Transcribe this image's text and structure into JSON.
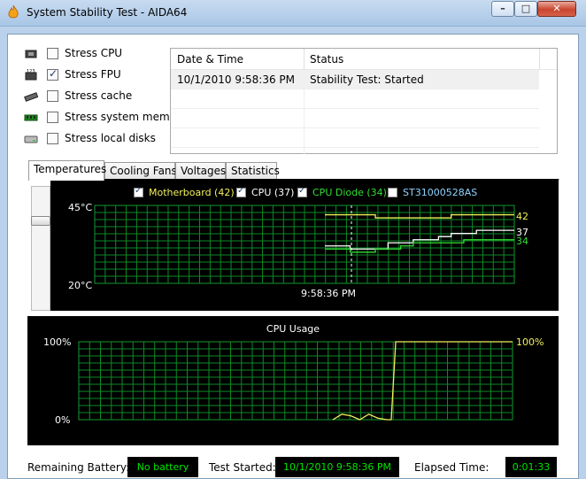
{
  "window": {
    "title": "System Stability Test - AIDA64"
  },
  "titlebar": {
    "minimize": "–",
    "maximize": "□",
    "close": "✕"
  },
  "stress_options": [
    {
      "label": "Stress CPU",
      "checked": false,
      "icon": "cpu-icon"
    },
    {
      "label": "Stress FPU",
      "checked": true,
      "icon": "fpu-icon"
    },
    {
      "label": "Stress cache",
      "checked": false,
      "icon": "cache-icon"
    },
    {
      "label": "Stress system memory",
      "checked": false,
      "icon": "memory-icon"
    },
    {
      "label": "Stress local disks",
      "checked": false,
      "icon": "disk-icon"
    }
  ],
  "log": {
    "headers": [
      "Date & Time",
      "Status"
    ],
    "rows": [
      {
        "datetime": "10/1/2010 9:58:36 PM",
        "status": "Stability Test: Started"
      }
    ]
  },
  "tabs": [
    "Temperatures",
    "Cooling Fans",
    "Voltages",
    "Statistics"
  ],
  "temperature_chart": {
    "legend": [
      {
        "label": "Motherboard (42)",
        "checked": true,
        "color": "#f0f05a"
      },
      {
        "label": "CPU (37)",
        "checked": true,
        "color": "#ffffff"
      },
      {
        "label": "CPU Diode (34)",
        "checked": true,
        "color": "#33dd33"
      },
      {
        "label": "ST31000528AS",
        "checked": false,
        "color": "#8fd3ff"
      }
    ],
    "y_max_label": "45°C",
    "y_min_label": "20°C",
    "time_label": "9:58:36 PM",
    "current_values": {
      "motherboard": "42",
      "cpu": "37",
      "cpu_diode": "34"
    }
  },
  "cpu_chart": {
    "title": "CPU Usage",
    "y_max_label": "100%",
    "y_min_label": "0%",
    "current_label": "100%"
  },
  "chart_data": [
    {
      "type": "line",
      "title": "",
      "ylim": [
        20,
        45
      ],
      "grid": true,
      "series": [
        {
          "name": "Motherboard",
          "color": "#f0f05a",
          "x": [
            0,
            3,
            4,
            5,
            10,
            15
          ],
          "values": [
            42,
            42,
            41,
            41,
            42,
            42
          ]
        },
        {
          "name": "CPU",
          "color": "#ffffff",
          "x": [
            0,
            1,
            2,
            3,
            5,
            6,
            7,
            8,
            9,
            10,
            11,
            12,
            13,
            14,
            15
          ],
          "values": [
            32,
            32,
            31,
            31,
            33,
            33,
            34,
            34,
            35,
            36,
            36,
            37,
            37,
            37,
            37
          ]
        },
        {
          "name": "CPU Diode",
          "color": "#33dd33",
          "x": [
            0,
            1,
            2,
            3,
            4,
            5,
            6,
            7,
            8,
            9,
            10,
            11,
            12,
            13,
            14,
            15
          ],
          "values": [
            31,
            31,
            30,
            30,
            31,
            31,
            32,
            33,
            33,
            33,
            33,
            34,
            34,
            34,
            34,
            34
          ]
        }
      ]
    },
    {
      "type": "line",
      "title": "CPU Usage",
      "ylim": [
        0,
        100
      ],
      "grid": true,
      "series": [
        {
          "name": "CPU Usage",
          "color": "#f0f05a",
          "x": [
            0,
            1,
            2,
            3,
            4,
            5,
            6,
            6.5,
            7,
            20
          ],
          "values": [
            0,
            7,
            5,
            0,
            7,
            2,
            0,
            0,
            100,
            100
          ]
        }
      ]
    }
  ],
  "status_bar": {
    "battery_label": "Remaining Battery:",
    "battery_value": "No battery",
    "started_label": "Test Started:",
    "started_value": "10/1/2010 9:58:36 PM",
    "elapsed_label": "Elapsed Time:",
    "elapsed_value": "0:01:33"
  }
}
